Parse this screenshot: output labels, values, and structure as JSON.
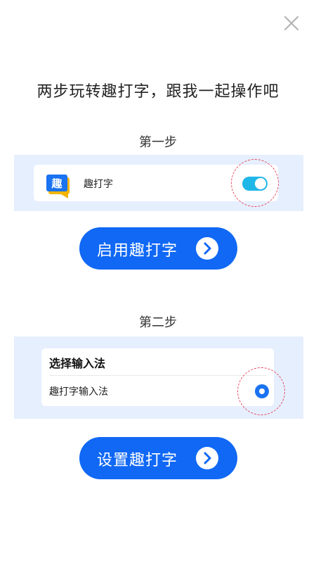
{
  "header": {
    "close_icon": "close-icon",
    "headline": "两步玩转趣打字，跟我一起操作吧"
  },
  "step1": {
    "title": "第一步",
    "app": {
      "logo_text": "趣",
      "logo_icon": "app-logo-icon",
      "name": "趣打字",
      "toggle_state": "on"
    },
    "button_label": "启用趣打字",
    "button_icon": "chevron-right-icon"
  },
  "step2": {
    "title": "第二步",
    "card_heading": "选择输入法",
    "ime_name": "趣打字输入法",
    "radio_state": "selected",
    "button_label": "设置趣打字",
    "button_icon": "chevron-right-icon"
  },
  "colors": {
    "primary": "#1068f5",
    "panel_bg": "#e6effe",
    "toggle_on": "#1fb6e8",
    "highlight_dash": "#e8485a",
    "logo_bg": "#1a73f0",
    "logo_accent": "#f5b400"
  }
}
